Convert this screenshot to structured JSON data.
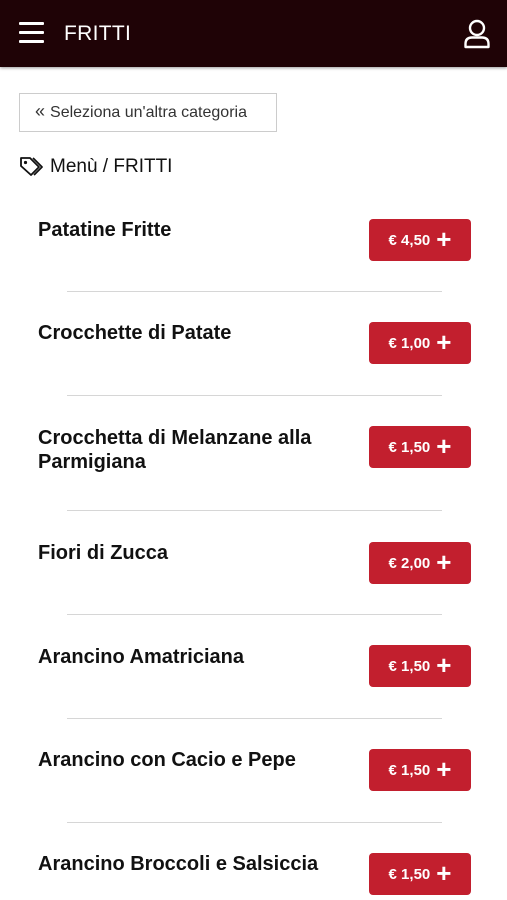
{
  "header": {
    "title": "FRITTI",
    "menu_icon": "hamburger-icon",
    "user_icon": "user-icon",
    "background": "#1f0306"
  },
  "back_button": {
    "label": "Seleziona un'altra categoria"
  },
  "breadcrumb": {
    "icon": "tags-icon",
    "text": "Menù / FRITTI"
  },
  "accent_color": "#c21f2e",
  "items": [
    {
      "name": "Patatine Fritte",
      "price": "€ 4,50"
    },
    {
      "name": "Crocchette di Patate",
      "price": "€ 1,00"
    },
    {
      "name": "Crocchetta di Melanzane alla Parmigiana",
      "price": "€ 1,50"
    },
    {
      "name": "Fiori di Zucca",
      "price": "€ 2,00"
    },
    {
      "name": "Arancino Amatriciana",
      "price": "€ 1,50"
    },
    {
      "name": "Arancino con Cacio e Pepe",
      "price": "€ 1,50"
    },
    {
      "name": "Arancino Broccoli e Salsiccia",
      "price": "€ 1,50"
    }
  ]
}
